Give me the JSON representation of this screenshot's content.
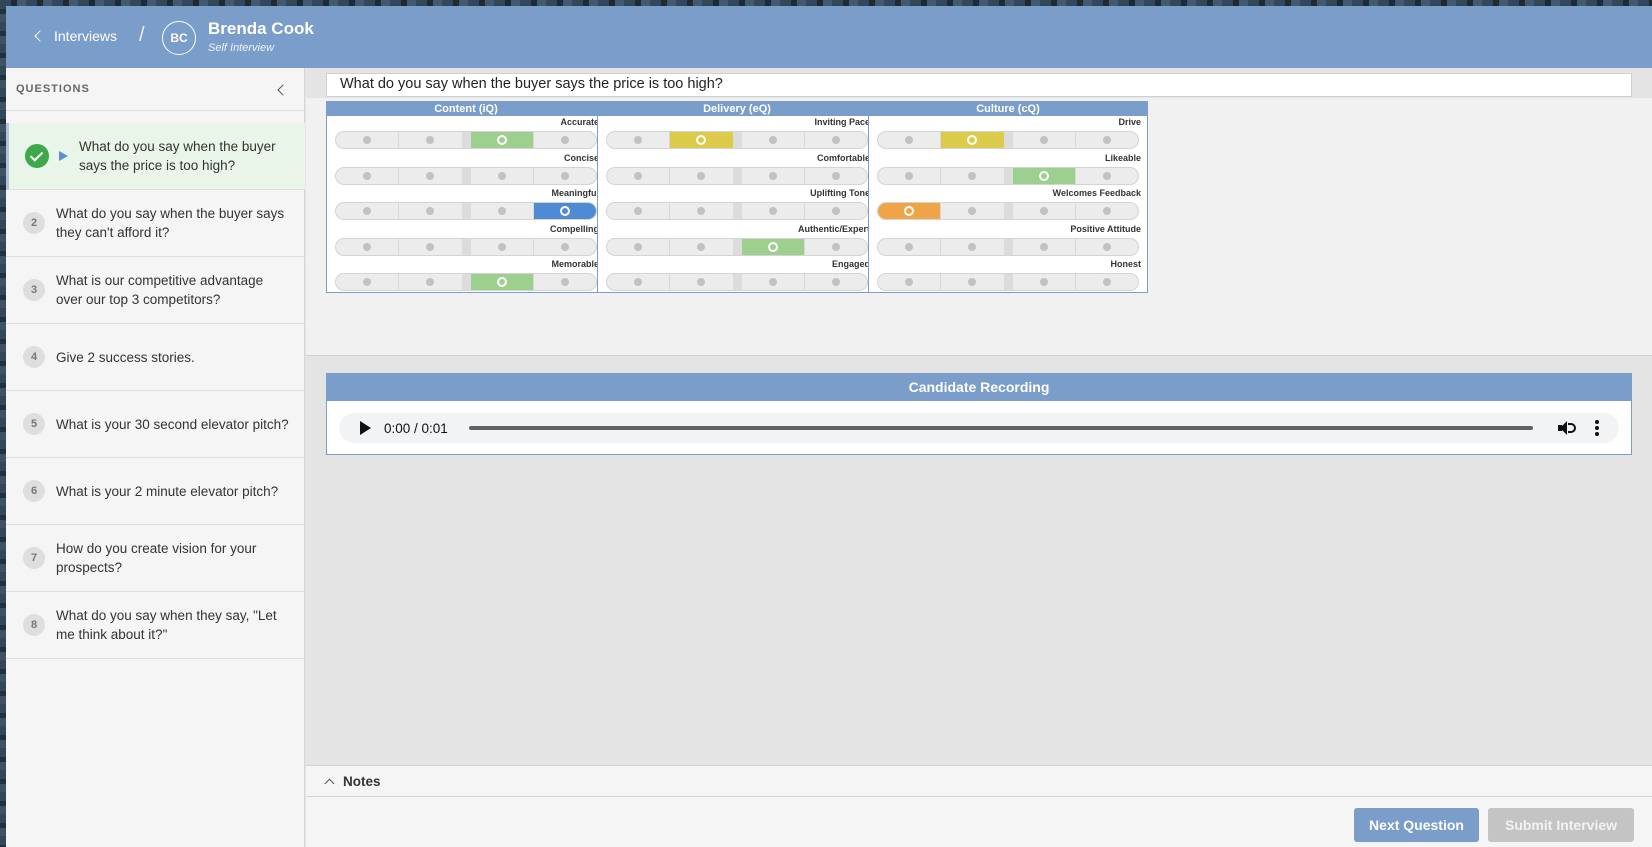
{
  "header": {
    "back_label": "Interviews",
    "separator": "/",
    "avatar_initials": "BC",
    "user_name": "Brenda Cook",
    "user_subtitle": "Self Interview"
  },
  "sidebar": {
    "title": "QUESTIONS",
    "questions": [
      {
        "num": "1",
        "text": "What do you say when the buyer says the price is too high?",
        "status": "completed",
        "active": true
      },
      {
        "num": "2",
        "text": "What do you say when the buyer says they can't afford it?"
      },
      {
        "num": "3",
        "text": "What is our competitive advantage over our top 3 competitors?"
      },
      {
        "num": "4",
        "text": "Give 2 success stories."
      },
      {
        "num": "5",
        "text": "What is your 30 second elevator pitch?"
      },
      {
        "num": "6",
        "text": "What is your 2 minute elevator pitch?"
      },
      {
        "num": "7",
        "text": "How do you create vision for your prospects?"
      },
      {
        "num": "8",
        "text": "What do you say when they say, \"Let me think about it?\""
      }
    ]
  },
  "main": {
    "question": "What do you say when the buyer says the price is too high?",
    "score_colors": {
      "1": "#f0a448",
      "2": "#dccb4a",
      "3": "#9dd08f",
      "4": "#4f8ad5"
    },
    "panels": [
      {
        "title": "Content (iQ)",
        "metrics": [
          {
            "label": "Accurate",
            "score": 3
          },
          {
            "label": "Concise",
            "score": 0
          },
          {
            "label": "Meaningful",
            "score": 4
          },
          {
            "label": "Compelling",
            "score": 0
          },
          {
            "label": "Memorable",
            "score": 3
          }
        ]
      },
      {
        "title": "Delivery (eQ)",
        "metrics": [
          {
            "label": "Inviting Pace",
            "score": 2
          },
          {
            "label": "Comfortable",
            "score": 0
          },
          {
            "label": "Uplifting Tone",
            "score": 0
          },
          {
            "label": "Authentic/Expert",
            "score": 3
          },
          {
            "label": "Engaged",
            "score": 0
          }
        ]
      },
      {
        "title": "Culture (cQ)",
        "metrics": [
          {
            "label": "Drive",
            "score": 2
          },
          {
            "label": "Likeable",
            "score": 3
          },
          {
            "label": "Welcomes Feedback",
            "score": 1
          },
          {
            "label": "Positive Attitude",
            "score": 0
          },
          {
            "label": "Honest",
            "score": 0
          }
        ]
      }
    ],
    "recording": {
      "title": "Candidate Recording",
      "time": "0:00 / 0:01"
    },
    "notes_label": "Notes",
    "next_label": "Next Question",
    "submit_label": "Submit Interview"
  }
}
